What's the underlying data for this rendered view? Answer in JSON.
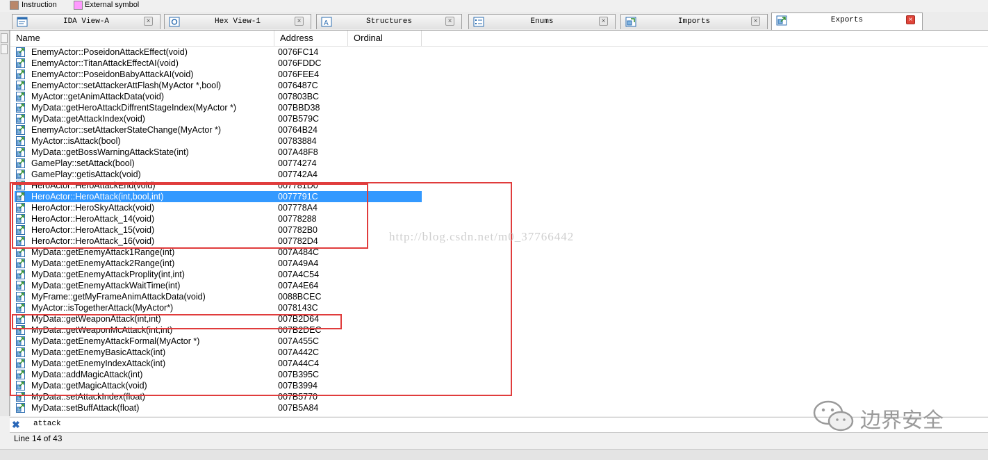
{
  "legend": [
    {
      "label": "Instruction",
      "color": "#b9876a"
    },
    {
      "label": "External symbol",
      "color": "#ff99ff"
    }
  ],
  "tabs": [
    {
      "label": "IDA View-A",
      "icon": "disassembly-icon"
    },
    {
      "label": "Hex View-1",
      "icon": "hex-view-icon"
    },
    {
      "label": "Structures",
      "icon": "structures-icon"
    },
    {
      "label": "Enums",
      "icon": "enums-icon"
    },
    {
      "label": "Imports",
      "icon": "imports-icon"
    },
    {
      "label": "Exports",
      "icon": "exports-icon"
    }
  ],
  "active_tab": "Exports",
  "columns": {
    "name": "Name",
    "address": "Address",
    "ordinal": "Ordinal"
  },
  "rows": [
    {
      "name": "EnemyActor::PoseidonAttackEffect(void)",
      "address": "0076FC14"
    },
    {
      "name": "EnemyActor::TitanAttackEffectAI(void)",
      "address": "0076FDDC"
    },
    {
      "name": "EnemyActor::PoseidonBabyAttackAI(void)",
      "address": "0076FEE4"
    },
    {
      "name": "EnemyActor::setAttackerAttFlash(MyActor *,bool)",
      "address": "0076487C"
    },
    {
      "name": "MyActor::getAnimAttackData(void)",
      "address": "007803BC"
    },
    {
      "name": "MyData::getHeroAttackDiffrentStageIndex(MyActor *)",
      "address": "007BBD38"
    },
    {
      "name": "MyData::getAttackIndex(void)",
      "address": "007B579C"
    },
    {
      "name": "EnemyActor::setAttackerStateChange(MyActor *)",
      "address": "00764B24"
    },
    {
      "name": "MyActor::isAttack(bool)",
      "address": "00783884"
    },
    {
      "name": "MyData::getBossWarningAttackState(int)",
      "address": "007A48F8"
    },
    {
      "name": "GamePlay::setAttack(bool)",
      "address": "00774274"
    },
    {
      "name": "GamePlay::getisAttack(void)",
      "address": "007742A4"
    },
    {
      "name": "HeroActor::HeroAttackEnd(void)",
      "address": "007781D0"
    },
    {
      "name": "HeroActor::HeroAttack(int,bool,int)",
      "address": "0077791C"
    },
    {
      "name": "HeroActor::HeroSkyAttack(void)",
      "address": "007778A4"
    },
    {
      "name": "HeroActor::HeroAttack_14(void)",
      "address": "00778288"
    },
    {
      "name": "HeroActor::HeroAttack_15(void)",
      "address": "007782B0"
    },
    {
      "name": "HeroActor::HeroAttack_16(void)",
      "address": "007782D4"
    },
    {
      "name": "MyData::getEnemyAttack1Range(int)",
      "address": "007A484C"
    },
    {
      "name": "MyData::getEnemyAttack2Range(int)",
      "address": "007A49A4"
    },
    {
      "name": "MyData::getEnemyAttackProplity(int,int)",
      "address": "007A4C54"
    },
    {
      "name": "MyData::getEnemyAttackWaitTime(int)",
      "address": "007A4E64"
    },
    {
      "name": "MyFrame::getMyFrameAnimAttackData(void)",
      "address": "0088BCEC"
    },
    {
      "name": "MyActor::isTogetherAttack(MyActor*)",
      "address": "0078143C"
    },
    {
      "name": "MyData::getWeaponAttack(int,int)",
      "address": "007B2D64"
    },
    {
      "name": "MyData::getWeaponMcAttack(int,int)",
      "address": "007B2DEC"
    },
    {
      "name": "MyData::getEnemyAttackFormal(MyActor *)",
      "address": "007A455C"
    },
    {
      "name": "MyData::getEnemyBasicAttack(int)",
      "address": "007A442C"
    },
    {
      "name": "MyData::getEnemyIndexAttack(int)",
      "address": "007A44C4"
    },
    {
      "name": "MyData::addMagicAttack(int)",
      "address": "007B395C"
    },
    {
      "name": "MyData::getMagicAttack(void)",
      "address": "007B3994"
    },
    {
      "name": "MyData::setAttackIndex(float)",
      "address": "007B5770"
    },
    {
      "name": "MyData::setBuffAttack(float)",
      "address": "007B5A84"
    }
  ],
  "selected_row": 13,
  "watermark": "http://blog.csdn.net/m0_37766442",
  "filter": {
    "text": "attack",
    "icon": "clear-filter-icon"
  },
  "status": "Line 14 of 43",
  "brand": {
    "text": "边界安全",
    "icon": "wechat-logo-icon"
  },
  "colors": {
    "annotation": "#e03c3c",
    "selection": "#3399ff",
    "active_tab_close": "#e0453a"
  }
}
